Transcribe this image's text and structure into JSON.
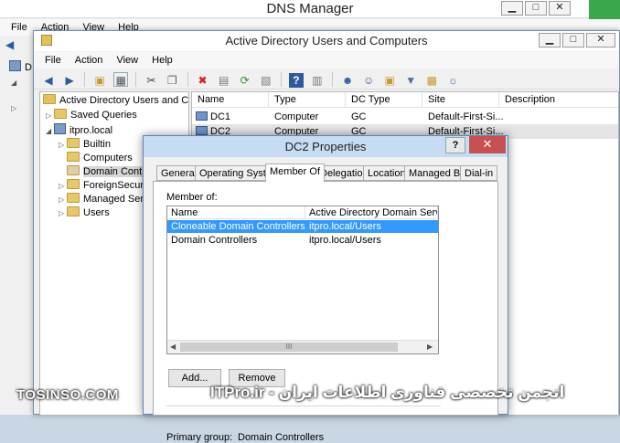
{
  "dns_window": {
    "title": "DNS Manager",
    "menu": [
      "File",
      "Action",
      "View",
      "Help"
    ],
    "tree_stub": "D"
  },
  "aduc_window": {
    "title": "Active Directory Users and Computers",
    "menu": [
      "File",
      "Action",
      "View",
      "Help"
    ],
    "tree": {
      "root": "Active Directory Users and Com",
      "saved_queries": "Saved Queries",
      "domain": "itpro.local",
      "children": [
        "Builtin",
        "Computers",
        "Domain Contro",
        "ForeignSecuri",
        "Managed Serv",
        "Users"
      ]
    },
    "list": {
      "columns": [
        "Name",
        "Type",
        "DC Type",
        "Site",
        "Description"
      ],
      "rows": [
        {
          "name": "DC1",
          "type": "Computer",
          "dc_type": "GC",
          "site": "Default-First-Si..."
        },
        {
          "name": "DC2",
          "type": "Computer",
          "dc_type": "GC",
          "site": "Default-First-Si..."
        }
      ]
    }
  },
  "properties_dialog": {
    "title": "DC2 Properties",
    "help_label": "?",
    "close_label": "✕",
    "tabs": [
      "General",
      "Operating System",
      "Member Of",
      "Delegation",
      "Location",
      "Managed By",
      "Dial-in"
    ],
    "member_of_label": "Member of:",
    "columns": [
      "Name",
      "Active Directory Domain Services F"
    ],
    "rows": [
      {
        "name": "Cloneable Domain Controllers",
        "folder": "itpro.local/Users"
      },
      {
        "name": "Domain Controllers",
        "folder": "itpro.local/Users"
      }
    ],
    "scroll_thumb": "III",
    "add_label": "Add...",
    "remove_label": "Remove",
    "primary_group_label": "Primary group:",
    "primary_group_value": "Domain Controllers"
  },
  "watermark": {
    "left": "TOSINSO.COM",
    "right": "انجمن تخصصی فناوری اطلاعات ایران - ITPro.ir"
  },
  "colors": {
    "selection": "#3399ff",
    "close_button": "#c75050"
  }
}
